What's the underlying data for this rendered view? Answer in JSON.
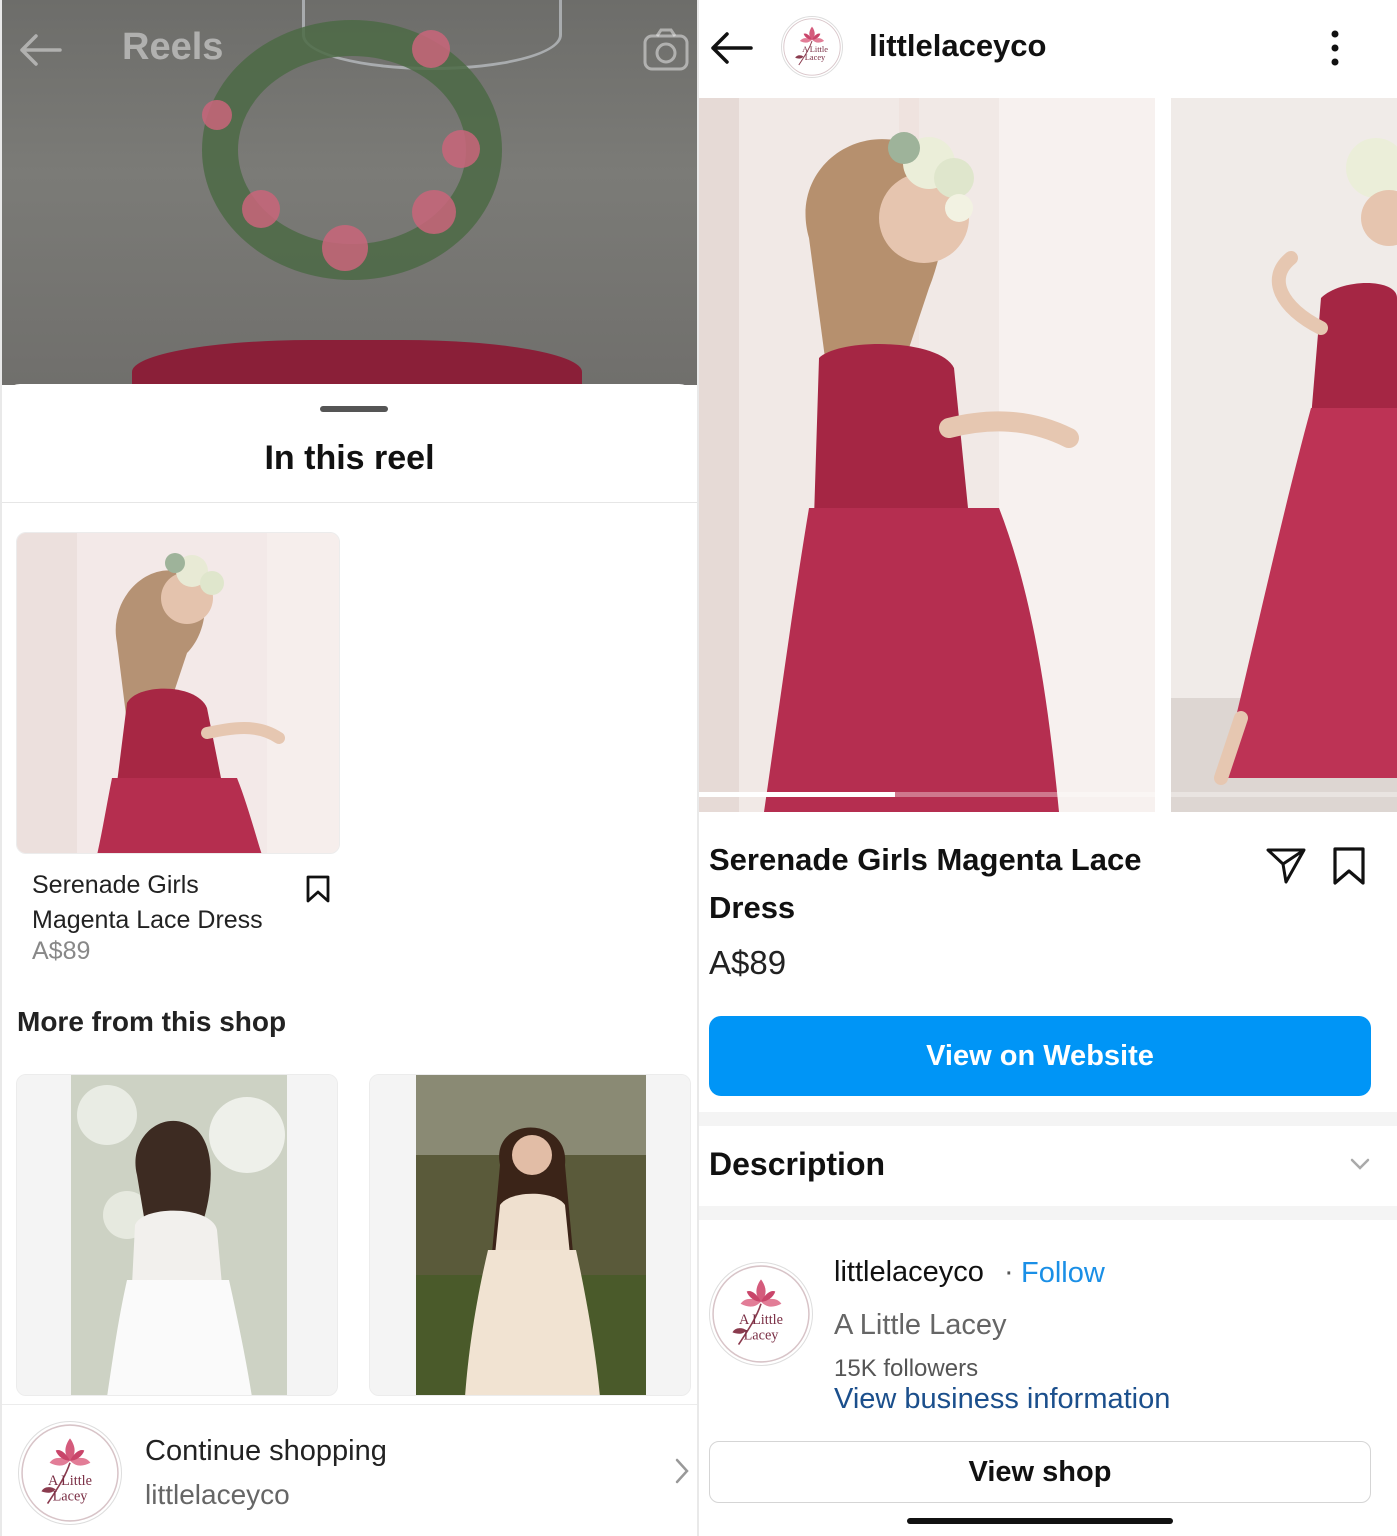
{
  "left": {
    "reel_header": {
      "title": "Reels"
    },
    "sheet": {
      "title": "In this reel",
      "product": {
        "name": "Serenade Girls Magenta Lace Dress",
        "price": "A$89"
      },
      "more_title": "More from this shop",
      "continue": {
        "title": "Continue shopping",
        "username": "littlelaceyco"
      }
    }
  },
  "right": {
    "header": {
      "username": "littlelaceyco"
    },
    "product": {
      "name": "Serenade Girls Magenta Lace Dress",
      "price": "A$89"
    },
    "website_button": "View on Website",
    "description_title": "Description",
    "shop": {
      "username": "littlelaceyco",
      "separator": "·",
      "follow": "Follow",
      "name": "A Little Lacey",
      "followers": "15K followers",
      "business_link": "View business information"
    },
    "view_shop_button": "View shop",
    "carousel": {
      "current_image": 1,
      "total_images": 2
    }
  },
  "logo_text": "A Little Lacey",
  "colors": {
    "accent_blue": "#0095f6",
    "follow_blue": "#1a8fe6",
    "link_blue": "#1b4f8c",
    "dress_magenta": "#b0254a"
  },
  "icons": [
    "back-arrow-icon",
    "camera-icon",
    "bookmark-icon",
    "share-icon",
    "more-vert-icon",
    "chevron-down-icon",
    "chevron-right-icon"
  ]
}
